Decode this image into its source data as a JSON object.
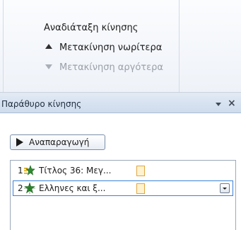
{
  "ribbon": {
    "group_title": "Αναδιάταξη κίνησης",
    "move_earlier": "Μετακίνηση νωρίτερα",
    "move_later": "Μετακίνηση αργότερα"
  },
  "pane": {
    "title": "Παράθυρο κίνησης",
    "close_glyph": "×",
    "play_label": "Αναπαραγωγή",
    "items": [
      {
        "number": "1",
        "label": "Τίτλος 36: Μεγ...",
        "icon": "fly-in-effect-icon"
      },
      {
        "number": "2",
        "label": "Ελληνες και ξ...",
        "icon": "star-effect-icon",
        "selected": true
      }
    ]
  },
  "colors": {
    "selection_border": "#3b82d6",
    "timing_fill": "#fff3cf",
    "timing_border": "#e0a640",
    "effect_green": "#2e8b2e"
  }
}
